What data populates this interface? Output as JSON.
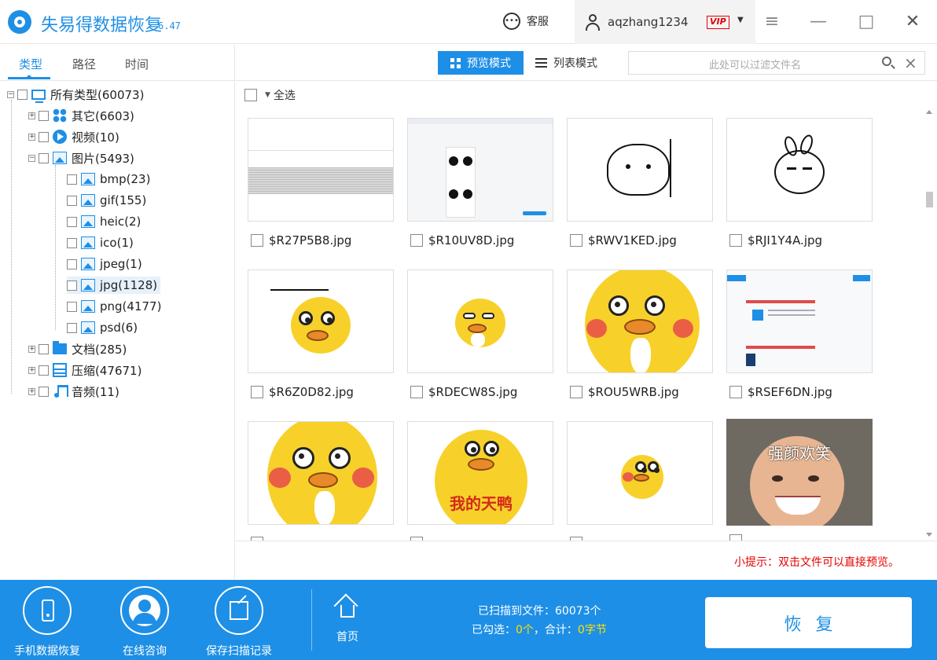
{
  "app": {
    "title": "失易得数据恢复",
    "version": "6.47",
    "service_label": "客服",
    "username": "aqzhang1234",
    "vip_label": "VIP",
    "accent_color": "#1e8fe6"
  },
  "window_controls": {
    "menu": "≡",
    "minimize": "—",
    "maximize": "□",
    "close": "✕"
  },
  "left_tabs": [
    "类型",
    "路径",
    "时间"
  ],
  "tree": {
    "root": "所有类型(60073)",
    "other": "其它(6603)",
    "video": "视频(10)",
    "image": "图片(5493)",
    "image_children": [
      "bmp(23)",
      "gif(155)",
      "heic(2)",
      "ico(1)",
      "jpeg(1)",
      "jpg(1128)",
      "png(4177)",
      "psd(6)"
    ],
    "docs": "文档(285)",
    "archive": "压缩(47671)",
    "audio": "音频(11)"
  },
  "toolbar": {
    "preview_mode": "预览模式",
    "list_mode": "列表模式",
    "filter_placeholder": "此处可以过滤文件名"
  },
  "select_all": "全选",
  "files": [
    {
      "name": "$R27P5B8.jpg"
    },
    {
      "name": "$R10UV8D.jpg"
    },
    {
      "name": "$RWV1KED.jpg"
    },
    {
      "name": "$RJI1Y4A.jpg"
    },
    {
      "name": "$R6Z0D82.jpg"
    },
    {
      "name": "$RDECW8S.jpg"
    },
    {
      "name": "$ROU5WRB.jpg"
    },
    {
      "name": "$RSEF6DN.jpg"
    },
    {
      "name": "",
      "overlay_text": "",
      "thumb": "duck-big"
    },
    {
      "name": "",
      "overlay_text": "我的天鸭",
      "thumb": "duck-text"
    },
    {
      "name": "",
      "overlay_text": "",
      "thumb": "duck-small"
    },
    {
      "name": "",
      "overlay_text": "强颜欢笑",
      "thumb": "kid"
    }
  ],
  "hint": "小提示：双击文件可以直接预览。",
  "bottom": {
    "phone_recovery": "手机数据恢复",
    "online_consult": "在线咨询",
    "save_scan": "保存扫描记录",
    "home": "首页",
    "scanned_label": "已扫描到文件：60073个",
    "checked_prefix": "已勾选：",
    "checked_count": "0个",
    "total_prefix": "，合计：",
    "total_size": "0字节",
    "recover": "恢复"
  }
}
